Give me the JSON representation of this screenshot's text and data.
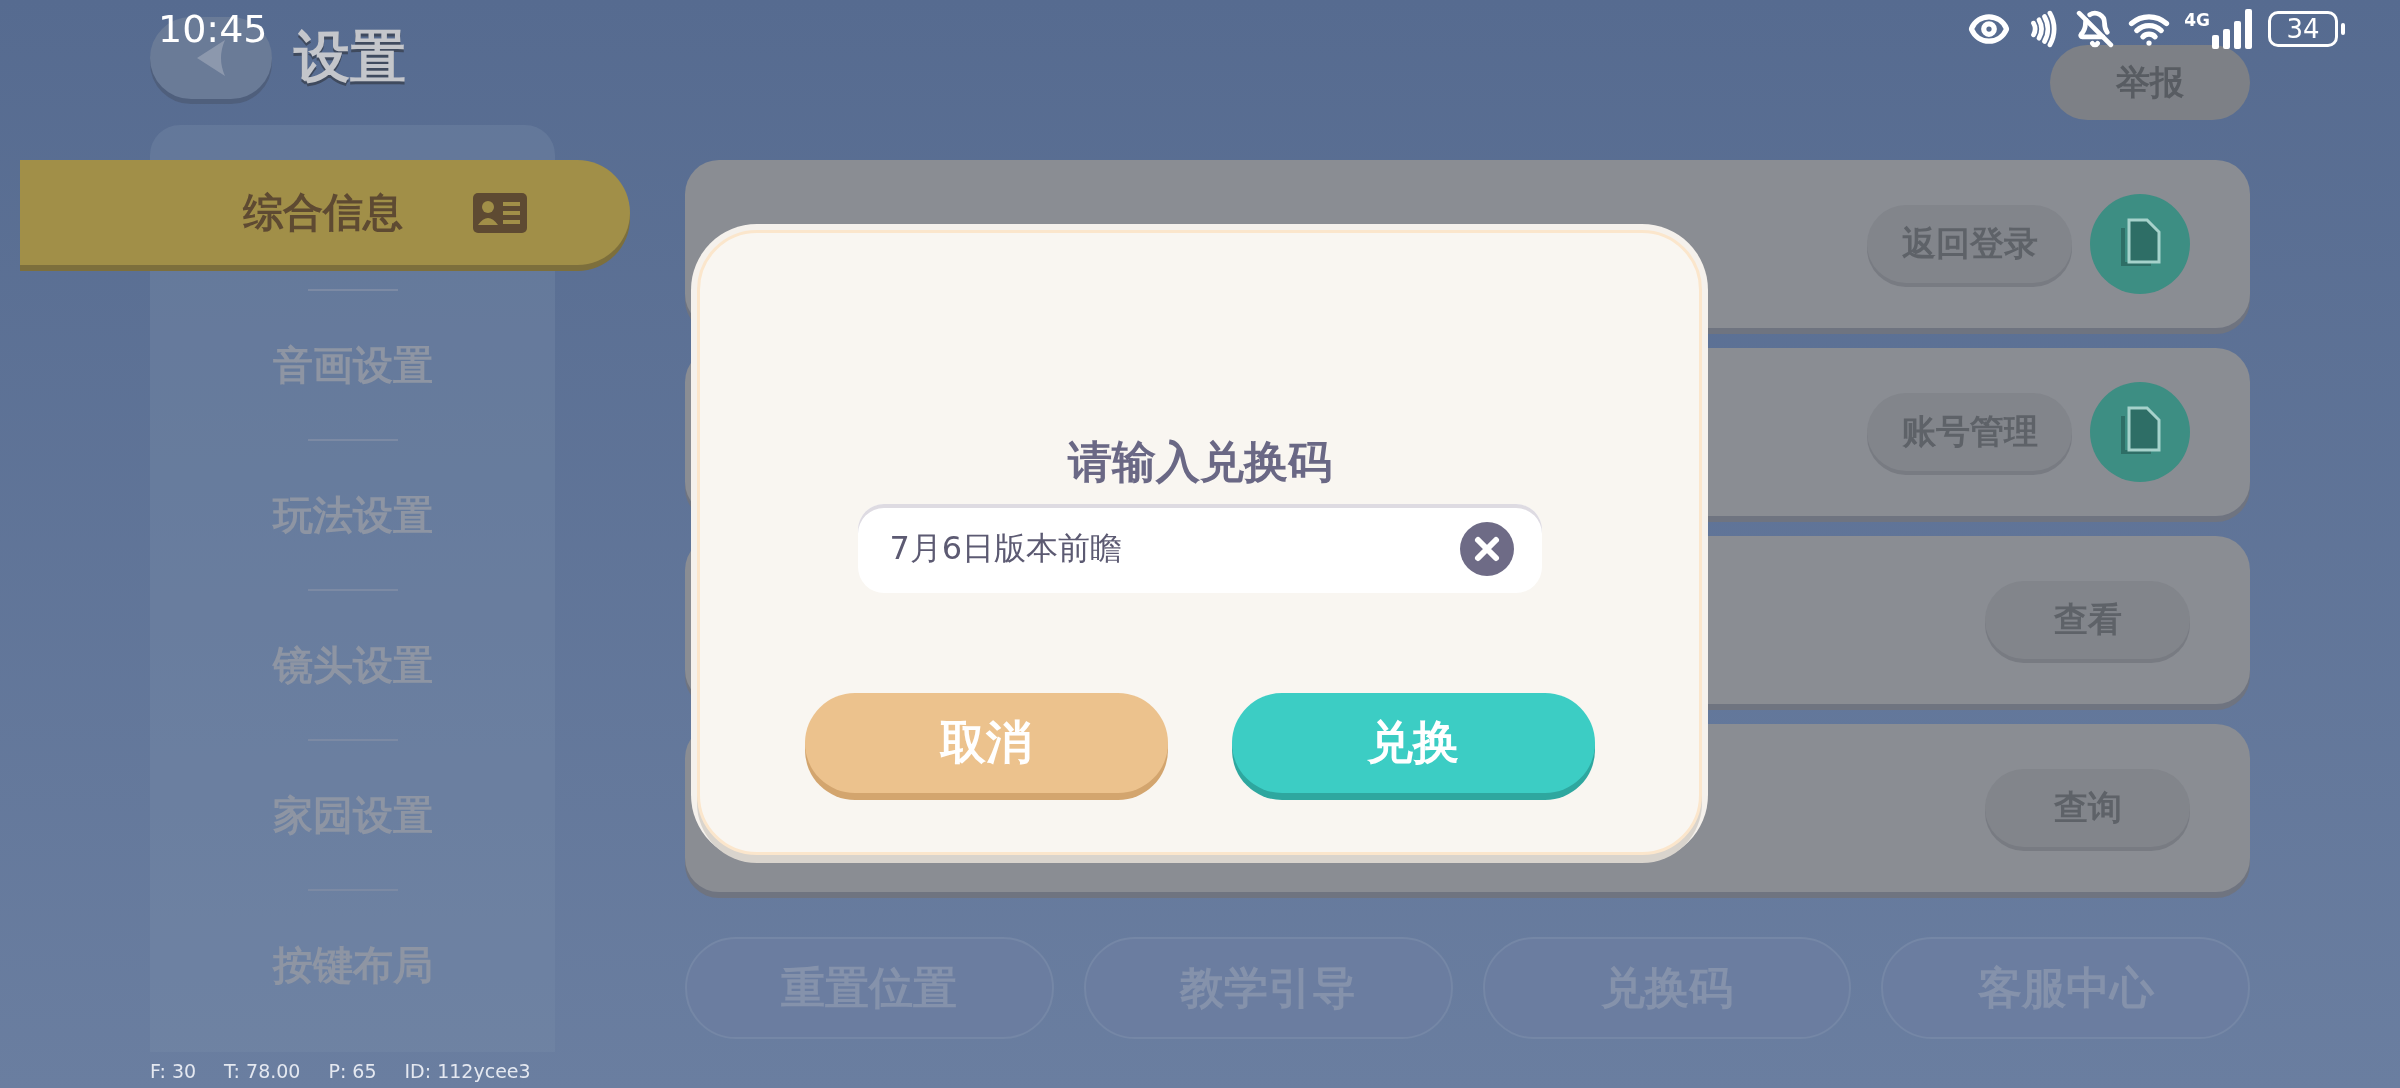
{
  "status_bar": {
    "time": "10:45",
    "network": "4G",
    "battery": "34"
  },
  "header": {
    "title": "设置",
    "report_button": "举报"
  },
  "sidebar": {
    "items": [
      {
        "label": "综合信息",
        "selected": true
      },
      {
        "label": "音画设置",
        "selected": false
      },
      {
        "label": "玩法设置",
        "selected": false
      },
      {
        "label": "镜头设置",
        "selected": false
      },
      {
        "label": "家园设置",
        "selected": false
      },
      {
        "label": "按键布局",
        "selected": false
      }
    ]
  },
  "cards": [
    {
      "buttons": [
        {
          "kind": "pill",
          "label": "返回登录"
        },
        {
          "kind": "copy"
        }
      ]
    },
    {
      "buttons": [
        {
          "kind": "pill",
          "label": "账号管理"
        },
        {
          "kind": "copy"
        }
      ]
    },
    {
      "buttons": [
        {
          "kind": "pill",
          "label": "查看"
        }
      ]
    },
    {
      "buttons": [
        {
          "kind": "pill",
          "label": "查询"
        }
      ]
    }
  ],
  "bottom_buttons": [
    "重置位置",
    "教学引导",
    "兑换码",
    "客服中心"
  ],
  "debug_info": [
    "F: 30",
    "T: 78.00",
    "P: 65",
    "ID: 112ycee3"
  ],
  "dialog": {
    "title": "请输入兑换码",
    "input": {
      "value": "7月6日版本前瞻"
    },
    "buttons": [
      {
        "kind": "cancel",
        "label": "取消"
      },
      {
        "kind": "confirm",
        "label": "兑换"
      }
    ]
  }
}
